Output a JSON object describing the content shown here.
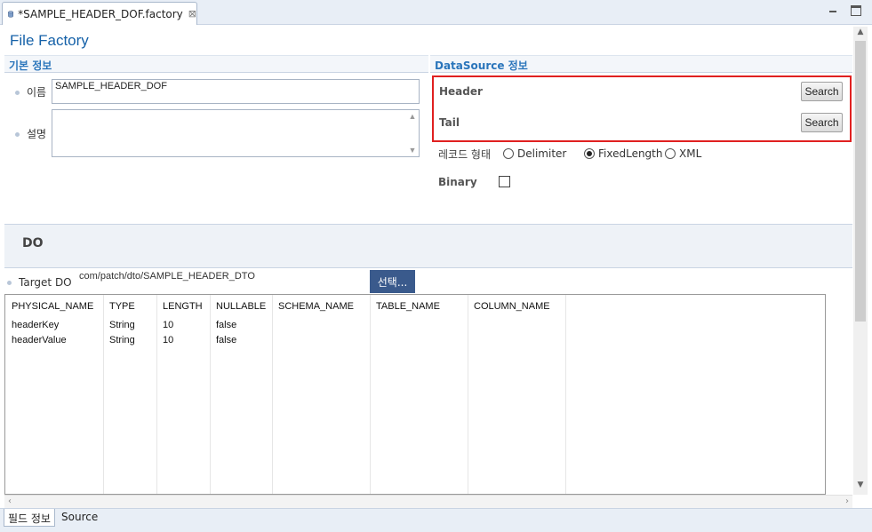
{
  "editor": {
    "tab_title": "*SAMPLE_HEADER_DOF.factory",
    "tab_icon": "database-icon",
    "close_glyph": "⊠"
  },
  "page": {
    "title": "File Factory"
  },
  "basic_info": {
    "header": "기본 정보",
    "name_label": "이름",
    "name_value": "SAMPLE_HEADER_DOF",
    "desc_label": "설명",
    "desc_value": ""
  },
  "datasource": {
    "header": "DataSource 정보",
    "header_label": "Header",
    "tail_label": "Tail",
    "search_label": "Search",
    "record_type_label": "레코드 형태",
    "record_options": [
      {
        "label": "Delimiter",
        "checked": false
      },
      {
        "label": "FixedLength",
        "checked": true
      },
      {
        "label": "XML",
        "checked": false
      }
    ],
    "binary_label": "Binary",
    "binary_checked": false
  },
  "do_section": {
    "header": "DO",
    "target_label": "Target DO",
    "target_value": "com/patch/dto/SAMPLE_HEADER_DTO",
    "select_label": "선택..."
  },
  "table": {
    "columns": [
      "PHYSICAL_NAME",
      "TYPE",
      "LENGTH",
      "NULLABLE",
      "SCHEMA_NAME",
      "TABLE_NAME",
      "COLUMN_NAME"
    ],
    "rows": [
      [
        "headerKey",
        "String",
        "10",
        "false",
        "",
        "",
        ""
      ],
      [
        "headerValue",
        "String",
        "10",
        "false",
        "",
        "",
        ""
      ]
    ]
  },
  "bottom_tabs": [
    {
      "label": "필드 정보",
      "active": true
    },
    {
      "label": "Source",
      "active": false
    }
  ],
  "colors": {
    "accent": "#1561a8",
    "section_text": "#2a75bb",
    "highlight": "#e02020",
    "select_button": "#3a5a8c"
  }
}
